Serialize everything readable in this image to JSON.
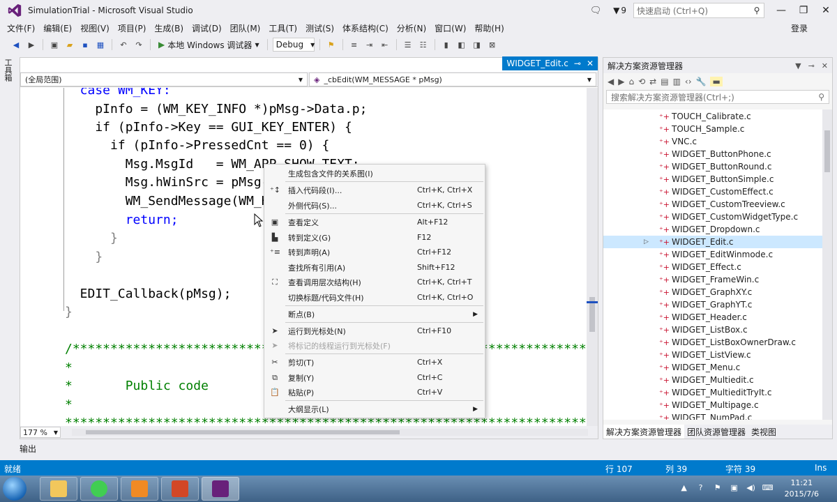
{
  "window": {
    "title": "SimulationTrial - Microsoft Visual Studio",
    "notification_count": "9",
    "quick_launch_placeholder": "快速启动 (Ctrl+Q)",
    "login": "登录"
  },
  "menu": [
    "文件(F)",
    "编辑(E)",
    "视图(V)",
    "项目(P)",
    "生成(B)",
    "调试(D)",
    "团队(M)",
    "工具(T)",
    "测试(S)",
    "体系结构(C)",
    "分析(N)",
    "窗口(W)",
    "帮助(H)"
  ],
  "toolbar": {
    "run_label": "本地 Windows 调试器",
    "config": "Debug"
  },
  "toolbox_label": "工具箱",
  "editor": {
    "tab_label": "WIDGET_Edit.c",
    "scope": "(全局范围)",
    "function": "_cbEdit(WM_MESSAGE * pMsg)",
    "zoom": "177 %"
  },
  "code": [
    "  case WM_KEY:",
    "    pInfo = (WM_KEY_INFO *)pMsg->Data.p;",
    "    if (pInfo->Key == GUI_KEY_ENTER) {",
    "      if (pInfo->PressedCnt == 0) {",
    "        Msg.MsgId   = WM_APP_SHOW_TEXT;",
    "        Msg.hWinSrc = pMsg->hWin;",
    "        WM_SendMessage(WM_HBKWIN, &Msg);",
    "        return;",
    "      }",
    "    }",
    "  EDIT_Callback(pMsg);",
    "}",
    "",
    "/*********************************************************************************",
    "*",
    "*       Public code",
    "*",
    "**********************************************************************************"
  ],
  "context_menu": [
    {
      "label": "生成包含文件的关系图(I)",
      "key": "",
      "icon": "graph-icon"
    },
    {
      "label": "插入代码段(I)...",
      "key": "Ctrl+K, Ctrl+X",
      "icon": "snippet-icon"
    },
    {
      "label": "外侧代码(S)...",
      "key": "Ctrl+K, Ctrl+S",
      "icon": ""
    },
    {
      "label": "查看定义",
      "key": "Alt+F12",
      "icon": "peek-icon"
    },
    {
      "label": "转到定义(G)",
      "key": "F12",
      "icon": "goto-def-icon"
    },
    {
      "label": "转到声明(A)",
      "key": "Ctrl+F12",
      "icon": "goto-decl-icon"
    },
    {
      "label": "查找所有引用(A)",
      "key": "Shift+F12",
      "icon": ""
    },
    {
      "label": "查看调用层次结构(H)",
      "key": "Ctrl+K, Ctrl+T",
      "icon": "call-hierarchy-icon"
    },
    {
      "label": "切换标题/代码文件(H)",
      "key": "Ctrl+K, Ctrl+O",
      "icon": ""
    },
    {
      "label": "断点(B)",
      "key": "",
      "icon": ""
    },
    {
      "label": "运行到光标处(N)",
      "key": "Ctrl+F10",
      "icon": "run-to-cursor-icon"
    },
    {
      "label": "将标记的线程运行到光标处(F)",
      "key": "",
      "icon": "run-thread-icon"
    },
    {
      "label": "剪切(T)",
      "key": "Ctrl+X",
      "icon": "scissors-icon"
    },
    {
      "label": "复制(Y)",
      "key": "Ctrl+C",
      "icon": "copy-icon"
    },
    {
      "label": "粘贴(P)",
      "key": "Ctrl+V",
      "icon": "paste-icon"
    },
    {
      "label": "大纲显示(L)",
      "key": "",
      "icon": ""
    }
  ],
  "solution_explorer": {
    "title": "解决方案资源管理器",
    "search_placeholder": "搜索解决方案资源管理器(Ctrl+;)",
    "files": [
      "TOUCH_Calibrate.c",
      "TOUCH_Sample.c",
      "VNC.c",
      "WIDGET_ButtonPhone.c",
      "WIDGET_ButtonRound.c",
      "WIDGET_ButtonSimple.c",
      "WIDGET_CustomEffect.c",
      "WIDGET_CustomTreeview.c",
      "WIDGET_CustomWidgetType.c",
      "WIDGET_Dropdown.c",
      "WIDGET_Edit.c",
      "WIDGET_EditWinmode.c",
      "WIDGET_Effect.c",
      "WIDGET_FrameWin.c",
      "WIDGET_GraphXY.c",
      "WIDGET_GraphYT.c",
      "WIDGET_Header.c",
      "WIDGET_ListBox.c",
      "WIDGET_ListBoxOwnerDraw.c",
      "WIDGET_ListView.c",
      "WIDGET_Menu.c",
      "WIDGET_Multiedit.c",
      "WIDGET_MultieditTryIt.c",
      "WIDGET_Multipage.c",
      "WIDGET_NumPad.c"
    ],
    "tabs": [
      "解决方案资源管理器",
      "团队资源管理器",
      "类视图"
    ]
  },
  "output_label": "输出",
  "status": {
    "ready": "就绪",
    "line": "行 107",
    "col": "列 39",
    "char": "字符 39",
    "mode": "Ins"
  },
  "taskbar": {
    "time": "11:21",
    "date": "2015/7/6"
  }
}
